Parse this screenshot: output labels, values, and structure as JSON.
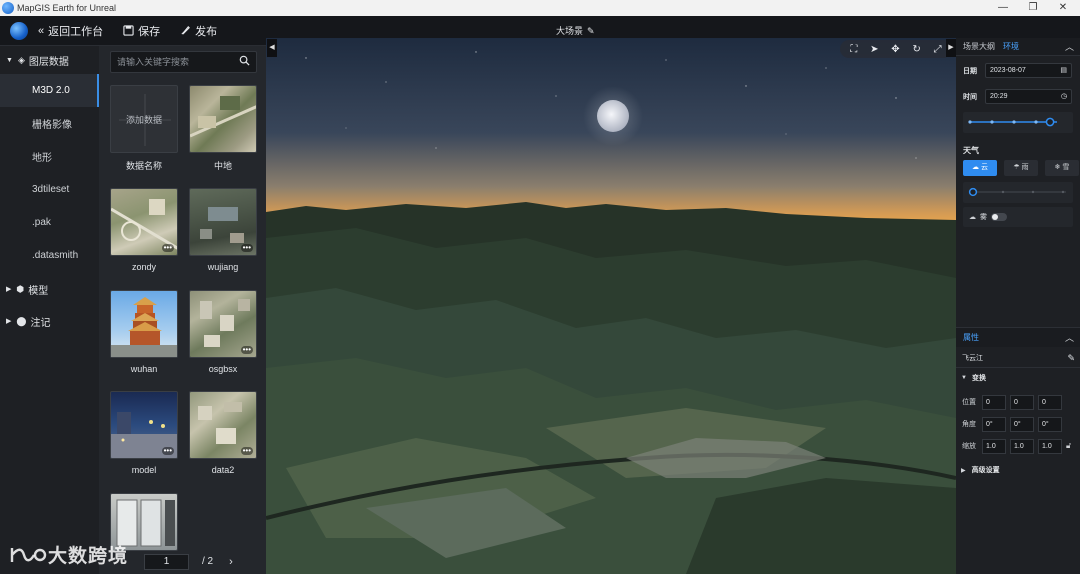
{
  "app": {
    "title": "MapGIS Earth for Unreal",
    "window_controls": [
      "—",
      "❐",
      "✕"
    ]
  },
  "toolbar": {
    "back_label": "返回工作台",
    "save_label": "保存",
    "publish_label": "发布",
    "scene_title": "大场景"
  },
  "nav": {
    "layers_label": "图层数据",
    "items": [
      {
        "label": "M3D 2.0",
        "active": true
      },
      {
        "label": "栅格影像"
      },
      {
        "label": "地形"
      },
      {
        "label": "3dtileset"
      },
      {
        "label": ".pak"
      },
      {
        "label": ".datasmith"
      }
    ],
    "model_label": "模型",
    "note_label": "注记"
  },
  "library": {
    "search_placeholder": "请输入关键字搜索",
    "add_label": "添加数据",
    "cards": [
      {
        "label": "数据名称",
        "kind": "add"
      },
      {
        "label": "中地",
        "kind": "aerial"
      },
      {
        "label": "zondy",
        "kind": "aerial2"
      },
      {
        "label": "wujiang",
        "kind": "city"
      },
      {
        "label": "wuhan",
        "kind": "tower"
      },
      {
        "label": "osgbsx",
        "kind": "city2"
      },
      {
        "label": "model",
        "kind": "night"
      },
      {
        "label": "data2",
        "kind": "aerial3"
      },
      {
        "label": "",
        "kind": "interior"
      }
    ],
    "pager": {
      "current": "1",
      "total": "/ 2",
      "next": "›"
    }
  },
  "right_panel": {
    "tab_scene_tree": "场景大纲",
    "tab_env": "环境",
    "date_label": "日期",
    "date_value": "2023-08-07",
    "time_label": "时间",
    "time_value": "20:29",
    "time_slider": 0.92,
    "weather_label": "天气",
    "weather_options": [
      {
        "label": "云",
        "active": true
      },
      {
        "label": "雨"
      },
      {
        "label": "雪"
      }
    ],
    "weather_slider": 0.0,
    "fog_label": "雾",
    "fog_on": false,
    "attr_label": "属性",
    "object_name": "飞云江",
    "transform_label": "变换",
    "position_label": "位置",
    "position": [
      "0",
      "0",
      "0"
    ],
    "rotation_label": "角度",
    "rotation": [
      "0°",
      "0°",
      "0°"
    ],
    "scale_label": "缩放",
    "scale": [
      "1.0",
      "1.0",
      "1.0"
    ],
    "advanced_label": "高级设置"
  },
  "watermark": {
    "text": "大数跨境"
  },
  "colors": {
    "accent": "#2f8cf0",
    "panel_bg": "#1e2024",
    "library_bg": "#24272c"
  }
}
